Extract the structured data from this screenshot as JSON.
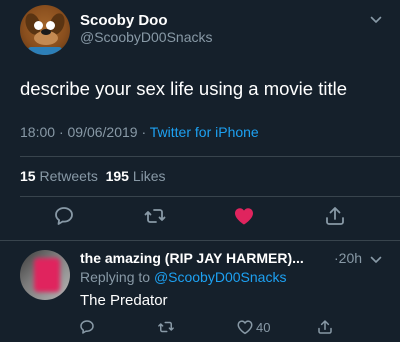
{
  "tweet": {
    "display_name": "Scooby Doo",
    "handle": "@ScoobyD00Snacks",
    "text": "describe your sex life using a movie title",
    "time": "18:00",
    "date": "09/06/2019",
    "separator": "·",
    "source": "Twitter for iPhone",
    "retweets_count": "15",
    "retweets_label": "Retweets",
    "likes_count": "195",
    "likes_label": "Likes",
    "liked": true
  },
  "reply": {
    "display_name": "the amazing (RIP JAY HARMER)...",
    "time": "·20h",
    "replying_prefix": "Replying to",
    "replying_to": "@ScoobyD00Snacks",
    "text": "The Predator",
    "like_count": "40"
  },
  "icons": {
    "reply": "reply-icon",
    "retweet": "retweet-icon",
    "like": "heart-icon",
    "share": "share-icon",
    "menu": "chevron-down-icon"
  },
  "colors": {
    "background": "#15202b",
    "text_secondary": "#8899a6",
    "accent": "#1da1f2",
    "like": "#e0245e",
    "divider": "#38444d"
  }
}
